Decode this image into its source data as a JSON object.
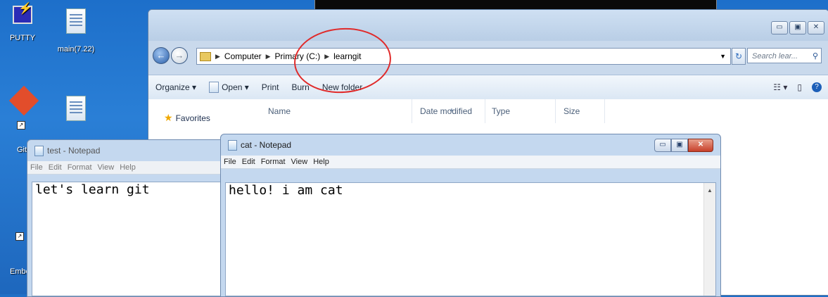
{
  "desktop": {
    "icons": [
      {
        "label": "PUTTY",
        "icon": "putty-icon"
      },
      {
        "label": "main(7.22)",
        "icon": "document-icon"
      },
      {
        "label": "Git",
        "icon": "git-icon"
      },
      {
        "label": "",
        "icon": "document-icon"
      },
      {
        "label": "Embe",
        "icon": "shortcut-icon"
      }
    ]
  },
  "explorer": {
    "address": {
      "crumbs": [
        "Computer",
        "Primary (C:)",
        "learngit"
      ]
    },
    "search_placeholder": "Search lear...",
    "toolbar": {
      "organize": "Organize ▾",
      "open": "Open ▾",
      "print": "Print",
      "burn": "Burn",
      "new_folder": "New folder"
    },
    "nav": {
      "favorites": "Favorites"
    },
    "columns": {
      "name": "Name",
      "date": "Date modified",
      "type": "Type",
      "size": "Size"
    },
    "annotation_color": "#e02a2a"
  },
  "notepad_test": {
    "title": "test - Notepad",
    "menu": [
      "File",
      "Edit",
      "Format",
      "View",
      "Help"
    ],
    "text": "let's learn git"
  },
  "notepad_cat": {
    "title": "cat - Notepad",
    "menu": [
      "File",
      "Edit",
      "Format",
      "View",
      "Help"
    ],
    "text": "hello! i am cat"
  }
}
